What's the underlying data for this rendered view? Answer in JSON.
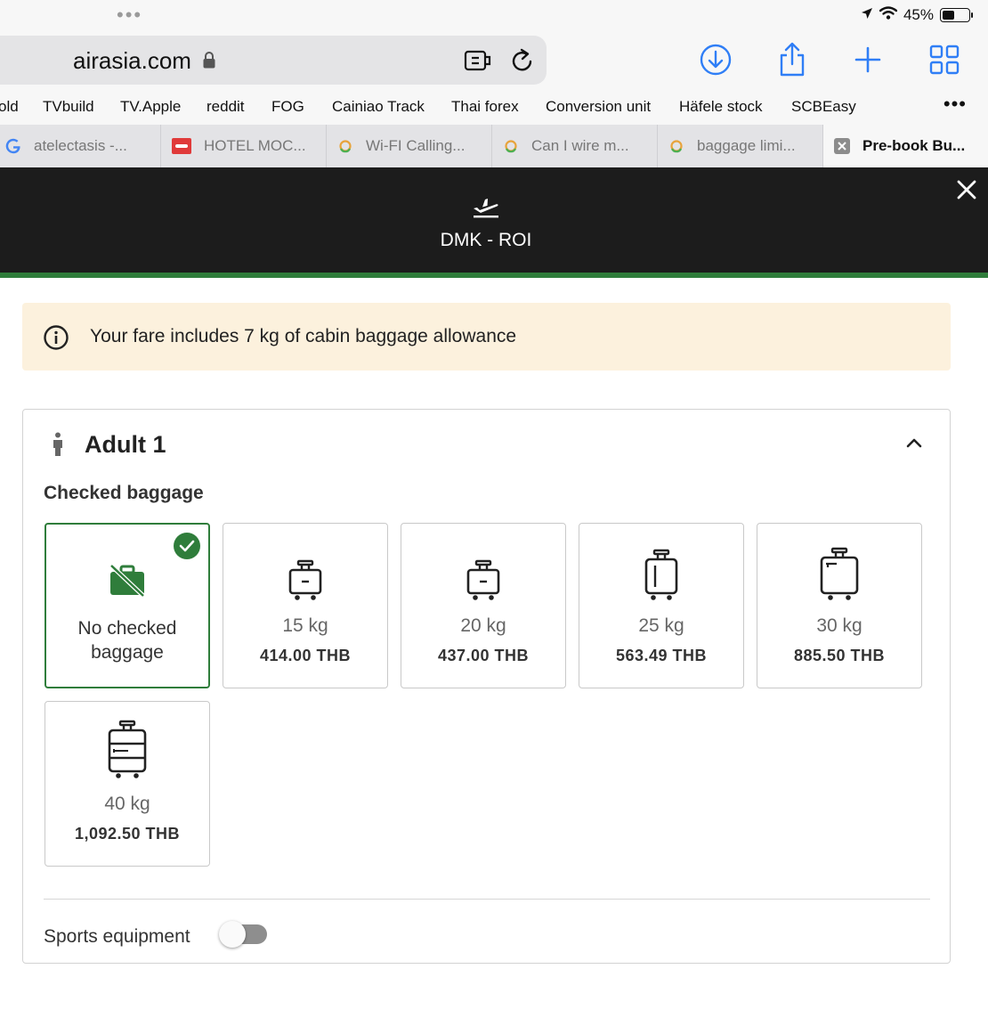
{
  "status_bar": {
    "dots": "•••",
    "battery_percent": "45%",
    "battery_level": 0.45
  },
  "browser": {
    "url": "airasia.com",
    "bookmarks": [
      "old",
      "TVbuild",
      "TV.Apple",
      "reddit",
      "FOG",
      "Cainiao Track",
      "Thai forex",
      "Conversion unit",
      "Häfele stock",
      "SCBEasy"
    ],
    "bookmarks_more": "•••",
    "tabs": [
      {
        "label": "atelectasis -...",
        "icon": "google-icon"
      },
      {
        "label": "HOTEL MOC...",
        "icon": "hotel-icon"
      },
      {
        "label": "Wi-FI Calling...",
        "icon": "site-icon"
      },
      {
        "label": "Can I wire m...",
        "icon": "site-icon"
      },
      {
        "label": "baggage limi...",
        "icon": "site-icon"
      },
      {
        "label": "Pre-book Bu...",
        "icon": "close-tab-icon"
      }
    ],
    "active_tab": 5
  },
  "modal": {
    "route": "DMK - ROI",
    "info_text": "Your fare includes 7 kg of cabin baggage allowance",
    "passenger": "Adult 1",
    "section_title": "Checked baggage",
    "options": [
      {
        "type": "none",
        "label": "No checked baggage",
        "selected": true
      },
      {
        "weight": "15 kg",
        "price": "414.00 THB",
        "selected": false
      },
      {
        "weight": "20 kg",
        "price": "437.00 THB",
        "selected": false
      },
      {
        "weight": "25 kg",
        "price": "563.49 THB",
        "selected": false
      },
      {
        "weight": "30 kg",
        "price": "885.50 THB",
        "selected": false
      },
      {
        "weight": "40 kg",
        "price": "1,092.50 THB",
        "selected": false
      }
    ],
    "sports_label": "Sports equipment",
    "sports_enabled": false
  },
  "colors": {
    "accent_green": "#2f7d3b",
    "header_bg": "#1c1c1c",
    "banner_bg": "#fcf1dd",
    "safari_blue": "#2f7ef6"
  }
}
